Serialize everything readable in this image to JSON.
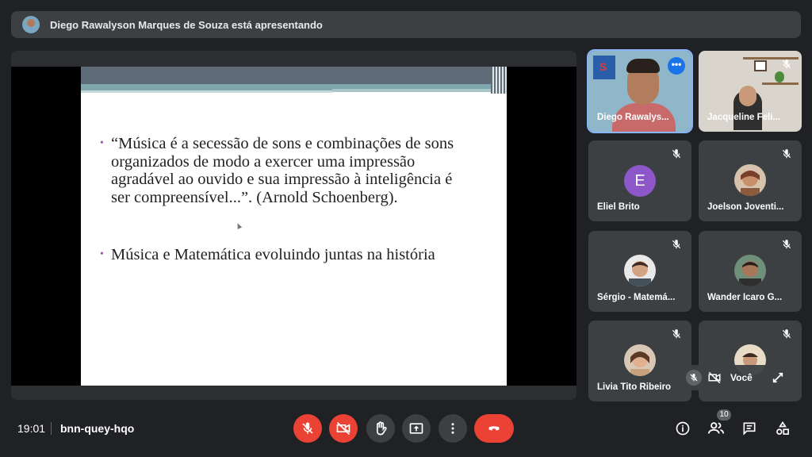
{
  "banner": {
    "text": "Diego Rawalyson Marques de Souza está apresentando",
    "avatar_icon": "presenter-avatar"
  },
  "slide": {
    "bullets": [
      "“Música é a secessão de sons e combinações de sons organizados de modo a exercer uma impressão agradável ao ouvido e sua impressão à inteligência é ser compreensível...”. (Arnold Schoenberg).",
      "Música e Matemática evoluindo juntas na história"
    ],
    "bullet_color": "#9b59b6"
  },
  "participants": [
    {
      "name": "Diego Rawalys...",
      "type": "video",
      "active": true,
      "more_icon": "more-options-icon"
    },
    {
      "name": "Jacqueline Feli...",
      "type": "video",
      "muted": true
    },
    {
      "name": "Eliel Brito",
      "type": "letter",
      "letter": "E",
      "muted": true
    },
    {
      "name": "Joelson Joventi...",
      "type": "photo",
      "muted": true
    },
    {
      "name": "Sérgio - Matemá...",
      "type": "photo",
      "muted": true
    },
    {
      "name": "Wander Icaro G...",
      "type": "photo",
      "muted": true
    },
    {
      "name": "Livia Tito Ribeiro",
      "type": "photo",
      "muted": true
    },
    {
      "name": "",
      "type": "photo",
      "muted": true
    }
  ],
  "self_view": {
    "label": "Você"
  },
  "bottom": {
    "time": "19:01",
    "meeting_code": "bnn-quey-hqo",
    "people_count": "10"
  },
  "colors": {
    "accent_red": "#ea4335",
    "active_outline": "#8ab4f8",
    "surface": "#3c4043",
    "background": "#202124"
  }
}
